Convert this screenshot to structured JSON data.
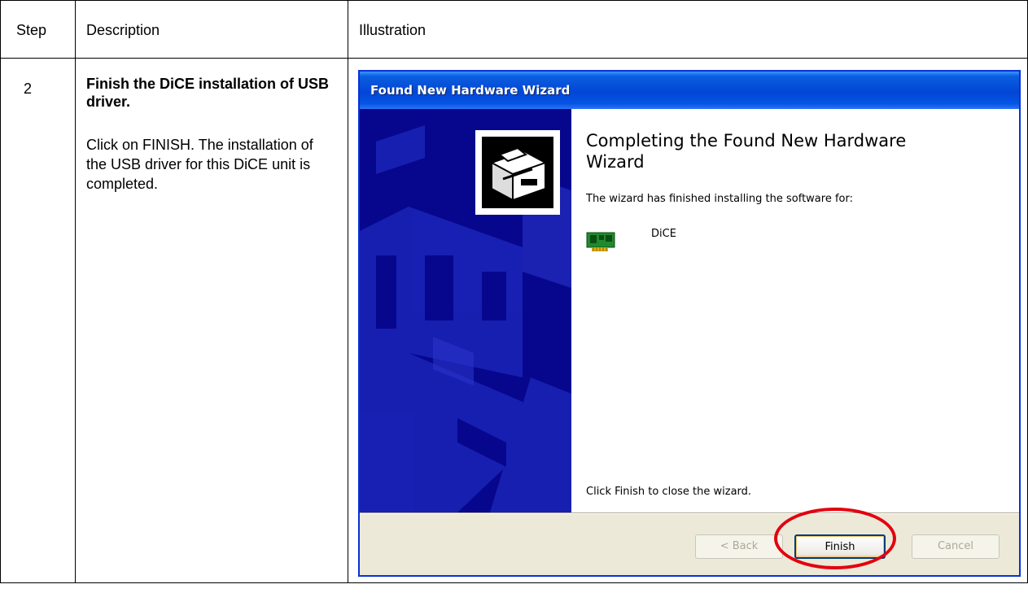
{
  "table": {
    "headers": {
      "step": "Step",
      "description": "Description",
      "illustration": "Illustration"
    },
    "row": {
      "step": "2",
      "title": "Finish the DiCE installation of USB driver.",
      "body": "Click on FINISH. The installation of the USB driver for this DiCE unit is completed."
    }
  },
  "wizard": {
    "title": "Found New Hardware Wizard",
    "heading": "Completing the Found New Hardware Wizard",
    "finished_text": "The wizard has finished installing the software for:",
    "device_name": "DiCE",
    "close_text": "Click Finish to close the wizard.",
    "buttons": {
      "back": "< Back",
      "finish": "Finish",
      "cancel": "Cancel"
    },
    "colors": {
      "titlebar": "#0346d5",
      "side_panel": "#07078d",
      "highlight": "#e3000f"
    }
  }
}
